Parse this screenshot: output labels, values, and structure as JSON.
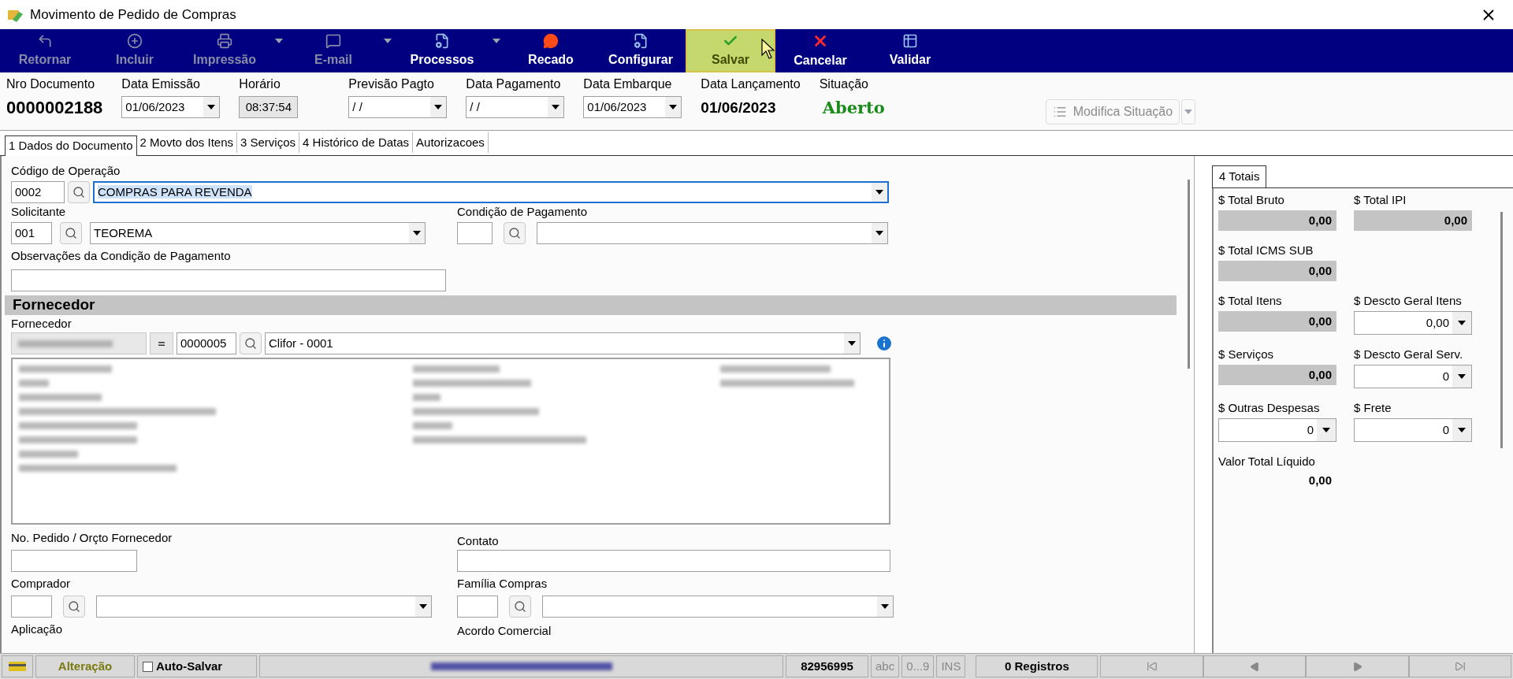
{
  "window": {
    "title": "Movimento de Pedido de Compras"
  },
  "toolbar": [
    {
      "label": "Retornar",
      "disabled": true,
      "dropdown": false,
      "highlighted": false
    },
    {
      "label": "Incluir",
      "disabled": true,
      "dropdown": false,
      "highlighted": false
    },
    {
      "label": "Impressão",
      "disabled": true,
      "dropdown": true,
      "highlighted": false
    },
    {
      "label": "E-mail",
      "disabled": true,
      "dropdown": true,
      "highlighted": false
    },
    {
      "label": "Processos",
      "disabled": false,
      "dropdown": true,
      "highlighted": false
    },
    {
      "label": "Recado",
      "disabled": false,
      "dropdown": false,
      "highlighted": false
    },
    {
      "label": "Configurar",
      "disabled": false,
      "dropdown": false,
      "highlighted": false
    },
    {
      "label": "Salvar",
      "disabled": false,
      "dropdown": false,
      "highlighted": true
    },
    {
      "label": "Cancelar",
      "disabled": false,
      "dropdown": false,
      "highlighted": false
    },
    {
      "label": "Validar",
      "disabled": false,
      "dropdown": false,
      "highlighted": false
    }
  ],
  "header": [
    {
      "label": "Nro Documento",
      "value": "0000002188",
      "kind": "number"
    },
    {
      "label": "Data Emissão",
      "value": "01/06/2023",
      "kind": "date"
    },
    {
      "label": "Horário",
      "value": "08:37:54",
      "kind": "readonly"
    },
    {
      "label": "Previsão Pagto",
      "value": "/ /",
      "kind": "date"
    },
    {
      "label": "Data Pagamento",
      "value": "/ /",
      "kind": "date"
    },
    {
      "label": "Data Embarque",
      "value": "01/06/2023",
      "kind": "date"
    },
    {
      "label": "Data Lançamento",
      "value": "01/06/2023",
      "kind": "number"
    },
    {
      "label": "Situação",
      "value": "Aberto",
      "kind": "status"
    }
  ],
  "modify_button": {
    "label": "Modifica Situação",
    "disabled": true
  },
  "tabs": [
    {
      "label": "1 Dados do Documento",
      "selected": true
    },
    {
      "label": "2 Movto dos Itens",
      "selected": false
    },
    {
      "label": "3 Serviços",
      "selected": false
    },
    {
      "label": "4 Histórico de Datas",
      "selected": false
    },
    {
      "label": "Autorizacoes",
      "selected": false
    }
  ],
  "form": {
    "operacao": {
      "label": "Código de Operação",
      "code": "0002",
      "value": "COMPRAS PARA REVENDA",
      "focused": true
    },
    "solicitante": {
      "label": "Solicitante",
      "code": "001",
      "value": "TEOREMA"
    },
    "condicao": {
      "label": "Condição de Pagamento"
    },
    "observacoes": {
      "label": "Observações da Condição de Pagamento"
    },
    "section": "Fornecedor",
    "fornecedor": {
      "label": "Fornecedor",
      "code": "0000005",
      "value": "Clifor - 0001"
    },
    "pedido": {
      "label": "No. Pedido / Orçto Fornecedor"
    },
    "contato": {
      "label": "Contato"
    },
    "comprador": {
      "label": "Comprador"
    },
    "familia": {
      "label": "Família Compras"
    },
    "aplicacao": {
      "label": "Aplicação"
    },
    "acordo": {
      "label": "Acordo Comercial"
    }
  },
  "totals_tab": {
    "label": "4 Totais",
    "selected": true
  },
  "totals": [
    [
      {
        "label": "$ Total Bruto",
        "value": "0,00",
        "kind": "readonly"
      },
      {
        "label": "$ Total IPI",
        "value": "0,00",
        "kind": "readonly"
      }
    ],
    [
      {
        "label": "$ Total ICMS SUB",
        "value": "0,00",
        "kind": "readonly"
      }
    ],
    [
      {
        "label": "$ Total Itens",
        "value": "0,00",
        "kind": "readonly"
      },
      {
        "label": "$ Descto Geral Itens",
        "value": "0,00",
        "kind": "combo"
      }
    ],
    [
      {
        "label": "$ Serviços",
        "value": "0,00",
        "kind": "readonly"
      },
      {
        "label": "$ Descto Geral Serv.",
        "value": "0",
        "kind": "combo"
      }
    ],
    [
      {
        "label": "$ Outras Despesas",
        "value": "0",
        "kind": "combo"
      },
      {
        "label": "$ Frete",
        "value": "0",
        "kind": "combo"
      }
    ],
    [
      {
        "label": "Valor Total Líquido",
        "value": "0,00",
        "kind": "plain"
      }
    ]
  ],
  "status_bar": {
    "mode": "Alteração",
    "auto_save": {
      "label": "Auto-Salvar",
      "checked": false
    },
    "code": "82956995",
    "indicators": [
      "abc",
      "0...9",
      "INS"
    ],
    "records": "0 Registros"
  }
}
